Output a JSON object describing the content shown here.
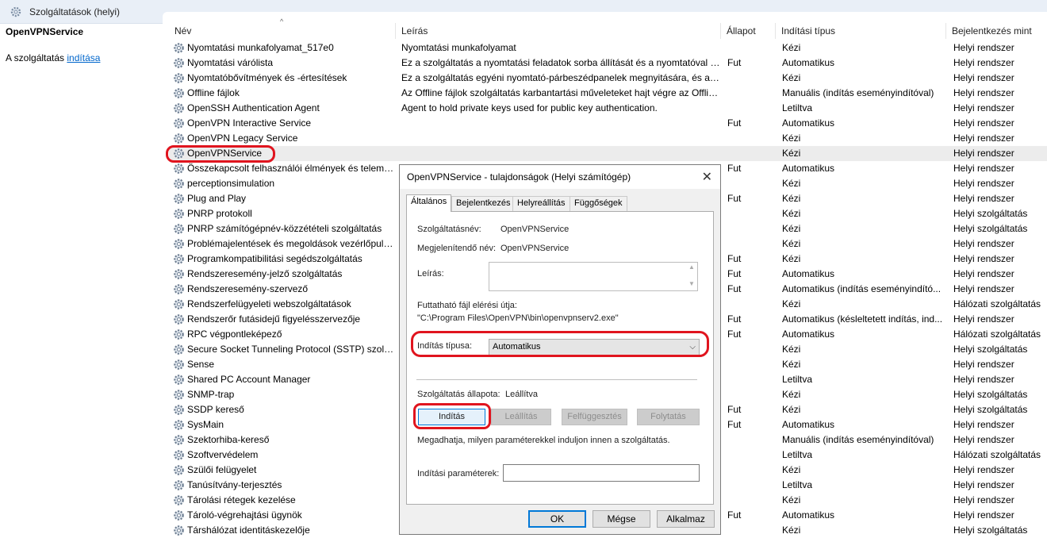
{
  "window": {
    "title": "Szolgáltatások (helyi)"
  },
  "left_pane": {
    "service_name": "OpenVPNService",
    "start_prefix": "A szolgáltatás ",
    "start_link": "indítása"
  },
  "columns": [
    "Név",
    "Leírás",
    "Állapot",
    "Indítási típus",
    "Bejelentkezés mint"
  ],
  "rows": [
    {
      "name": "Nyomtatási munkafolyamat_517e0",
      "desc": "Nyomtatási munkafolyamat",
      "state": "",
      "type": "Kézi",
      "logon": "Helyi rendszer"
    },
    {
      "name": "Nyomtatási várólista",
      "desc": "Ez a szolgáltatás a nyomtatási feladatok sorba állítását és a nyomtatóval fo...",
      "state": "Fut",
      "type": "Automatikus",
      "logon": "Helyi rendszer"
    },
    {
      "name": "Nyomtatóbővítmények és -értesítések",
      "desc": "Ez a szolgáltatás egyéni nyomtató-párbeszédpanelek megnyitására, és a tá...",
      "state": "",
      "type": "Kézi",
      "logon": "Helyi rendszer"
    },
    {
      "name": "Offline fájlok",
      "desc": "Az Offline fájlok szolgáltatás karbantartási műveleteket hajt végre az Offlin...",
      "state": "",
      "type": "Manuális (indítás eseményindítóval)",
      "logon": "Helyi rendszer"
    },
    {
      "name": "OpenSSH Authentication Agent",
      "desc": "Agent to hold private keys used for public key authentication.",
      "state": "",
      "type": "Letiltva",
      "logon": "Helyi rendszer"
    },
    {
      "name": "OpenVPN Interactive Service",
      "desc": "",
      "state": "Fut",
      "type": "Automatikus",
      "logon": "Helyi rendszer"
    },
    {
      "name": "OpenVPN Legacy Service",
      "desc": "",
      "state": "",
      "type": "Kézi",
      "logon": "Helyi rendszer"
    },
    {
      "name": "OpenVPNService",
      "desc": "",
      "state": "",
      "type": "Kézi",
      "logon": "Helyi rendszer",
      "selected": true
    },
    {
      "name": "Összekapcsolt felhasználói élmények és telemet...",
      "desc": "",
      "state": "Fut",
      "type": "Automatikus",
      "logon": "Helyi rendszer"
    },
    {
      "name": "perceptionsimulation",
      "desc": "",
      "state": "",
      "type": "Kézi",
      "logon": "Helyi rendszer"
    },
    {
      "name": "Plug and Play",
      "desc": "",
      "state": "Fut",
      "type": "Kézi",
      "logon": "Helyi rendszer"
    },
    {
      "name": "PNRP protokoll",
      "desc": "",
      "state": "",
      "type": "Kézi",
      "logon": "Helyi szolgáltatás"
    },
    {
      "name": "PNRP számítógépnév-közzétételi szolgáltatás",
      "desc": "",
      "state": "",
      "type": "Kézi",
      "logon": "Helyi szolgáltatás"
    },
    {
      "name": "Problémajelentések és megoldások vezérlőpult-...",
      "desc": "",
      "state": "",
      "type": "Kézi",
      "logon": "Helyi rendszer"
    },
    {
      "name": "Programkompatibilitási segédszolgáltatás",
      "desc": "",
      "state": "Fut",
      "type": "Kézi",
      "logon": "Helyi rendszer"
    },
    {
      "name": "Rendszeresemény-jelző szolgáltatás",
      "desc": "",
      "state": "Fut",
      "type": "Automatikus",
      "logon": "Helyi rendszer"
    },
    {
      "name": "Rendszeresemény-szervező",
      "desc": "",
      "state": "Fut",
      "type": "Automatikus (indítás eseményindító...",
      "logon": "Helyi rendszer"
    },
    {
      "name": "Rendszerfelügyeleti webszolgáltatások",
      "desc": "",
      "state": "",
      "type": "Kézi",
      "logon": "Hálózati szolgáltatás"
    },
    {
      "name": "Rendszerőr futásidejű figyelésszervezője",
      "desc": "",
      "state": "Fut",
      "type": "Automatikus (késleltetett indítás, ind...",
      "logon": "Helyi rendszer"
    },
    {
      "name": "RPC végpontleképező",
      "desc": "",
      "state": "Fut",
      "type": "Automatikus",
      "logon": "Hálózati szolgáltatás"
    },
    {
      "name": "Secure Socket Tunneling Protocol (SSTP) szolgál...",
      "desc": "",
      "state": "",
      "type": "Kézi",
      "logon": "Helyi szolgáltatás"
    },
    {
      "name": "Sense",
      "desc": "",
      "state": "",
      "type": "Kézi",
      "logon": "Helyi rendszer"
    },
    {
      "name": "Shared PC Account Manager",
      "desc": "",
      "state": "",
      "type": "Letiltva",
      "logon": "Helyi rendszer"
    },
    {
      "name": "SNMP-trap",
      "desc": "",
      "state": "",
      "type": "Kézi",
      "logon": "Helyi szolgáltatás"
    },
    {
      "name": "SSDP kereső",
      "desc": "",
      "state": "Fut",
      "type": "Kézi",
      "logon": "Helyi szolgáltatás"
    },
    {
      "name": "SysMain",
      "desc": "",
      "state": "Fut",
      "type": "Automatikus",
      "logon": "Helyi rendszer"
    },
    {
      "name": "Szektorhiba-kereső",
      "desc": "",
      "state": "",
      "type": "Manuális (indítás eseményindítóval)",
      "logon": "Helyi rendszer"
    },
    {
      "name": "Szoftvervédelem",
      "desc": "",
      "state": "",
      "type": "Letiltva",
      "logon": "Hálózati szolgáltatás"
    },
    {
      "name": "Szülői felügyelet",
      "desc": "",
      "state": "",
      "type": "Kézi",
      "logon": "Helyi rendszer"
    },
    {
      "name": "Tanúsítvány-terjesztés",
      "desc": "",
      "state": "",
      "type": "Letiltva",
      "logon": "Helyi rendszer"
    },
    {
      "name": "Tárolási rétegek kezelése",
      "desc": "",
      "state": "",
      "type": "Kézi",
      "logon": "Helyi rendszer"
    },
    {
      "name": "Tároló-végrehajtási ügynök",
      "desc": "",
      "state": "Fut",
      "type": "Automatikus",
      "logon": "Helyi rendszer"
    },
    {
      "name": "Társhálózat identitáskezelője",
      "desc": "",
      "state": "",
      "type": "Kézi",
      "logon": "Helyi szolgáltatás"
    }
  ],
  "dialog": {
    "title": "OpenVPNService - tulajdonságok (Helyi számítógép)",
    "tabs": [
      "Általános",
      "Bejelentkezés",
      "Helyreállítás",
      "Függőségek"
    ],
    "service_name_label": "Szolgáltatásnév:",
    "service_name_value": "OpenVPNService",
    "display_name_label": "Megjelenítendő név:",
    "display_name_value": "OpenVPNService",
    "description_label": "Leírás:",
    "path_label": "Futtatható fájl elérési útja:",
    "path_value": "\"C:\\Program Files\\OpenVPN\\bin\\openvpnserv2.exe\"",
    "startup_type_label": "Indítás típusa:",
    "startup_type_value": "Automatikus",
    "status_label": "Szolgáltatás állapota:",
    "status_value": "Leállítva",
    "btn_start": "Indítás",
    "btn_stop": "Leállítás",
    "btn_pause": "Felfüggesztés",
    "btn_resume": "Folytatás",
    "hint": "Megadhatja, milyen paraméterekkel induljon innen a szolgáltatás.",
    "params_label": "Indítási paraméterek:",
    "ok": "OK",
    "cancel": "Mégse",
    "apply": "Alkalmaz"
  }
}
